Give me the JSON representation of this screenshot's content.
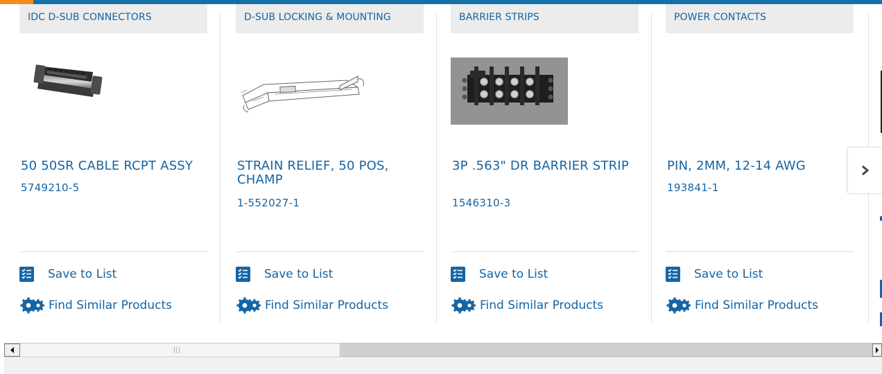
{
  "products": [
    {
      "category": "IDC D-SUB CONNECTORS",
      "title": "50 50SR CABLE RCPT ASSY",
      "part_number": "5749210-5",
      "image": "idc-dsub-connector-photo",
      "save_label": "Save to List",
      "find_label": "Find Similar Products"
    },
    {
      "category": "D-SUB LOCKING & MOUNTING",
      "title": "STRAIN RELIEF, 50 POS, CHAMP",
      "part_number": "1-552027-1",
      "image": "strain-relief-drawing",
      "save_label": "Save to List",
      "find_label": "Find Similar Products"
    },
    {
      "category": "BARRIER STRIPS",
      "title": "3P .563\" DR BARRIER STRIP",
      "part_number": "1546310-3",
      "image": "barrier-strip-photo",
      "save_label": "Save to List",
      "find_label": "Find Similar Products"
    },
    {
      "category": "POWER CONTACTS",
      "title": "PIN, 2MM, 12-14 AWG",
      "part_number": "193841-1",
      "image": "",
      "save_label": "Save to List",
      "find_label": "Find Similar Products"
    }
  ],
  "icons": {
    "save": "checklist-icon",
    "find": "double-gear-icon",
    "next": "chevron-right-icon",
    "scroll_left": "scroll-left-arrow-icon",
    "scroll_right": "scroll-right-arrow-icon"
  },
  "colors": {
    "link": "#1563a0",
    "accent_orange": "#f28c1b",
    "top_bar": "#1570a8",
    "category_bg": "#ececec"
  }
}
